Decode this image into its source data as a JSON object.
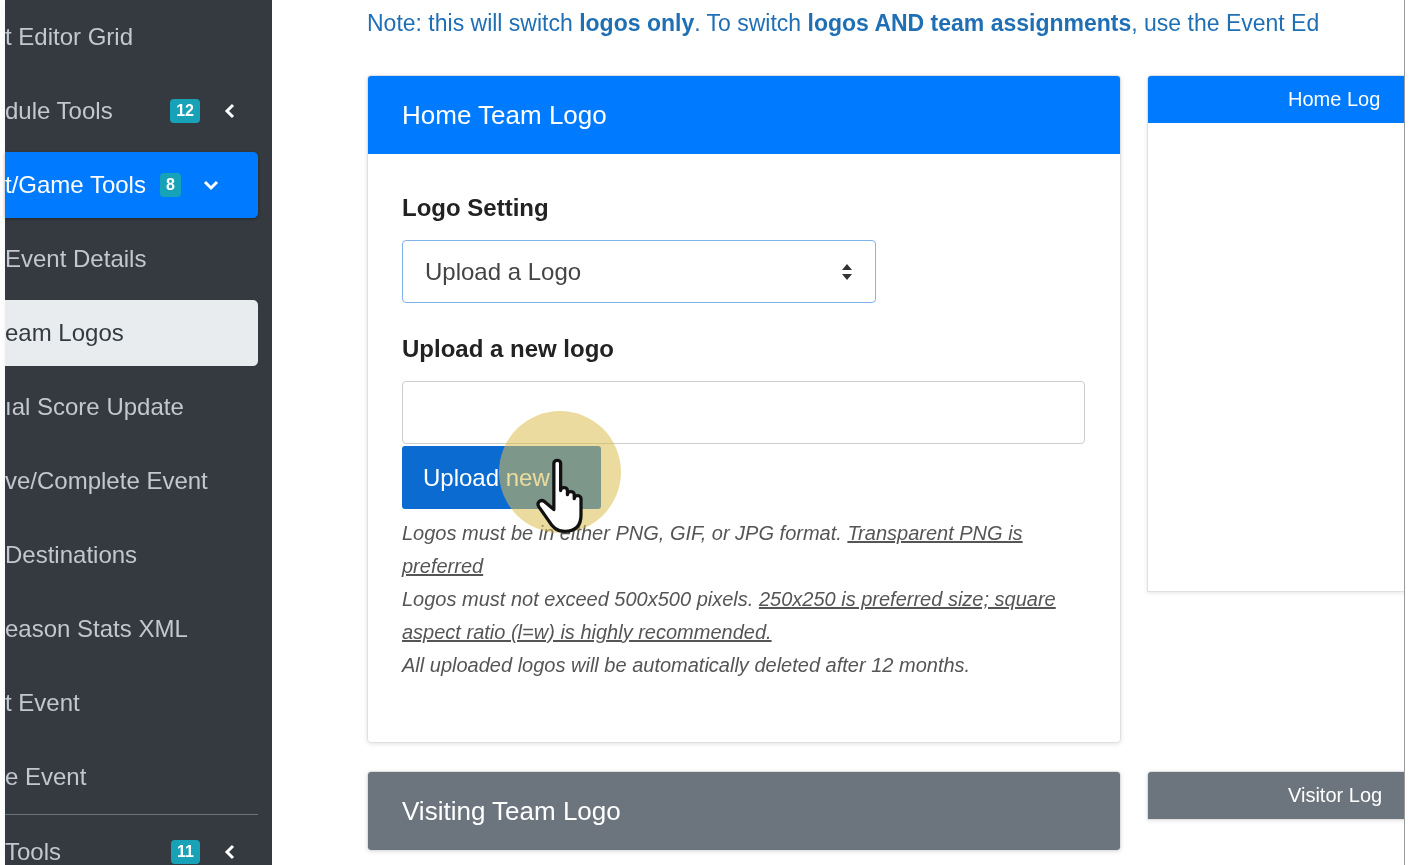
{
  "sidebar": {
    "items": [
      {
        "kind": "link",
        "label": "t Editor Grid",
        "selected": false
      },
      {
        "kind": "group",
        "label": "dule Tools",
        "badge": "12",
        "expanded": false,
        "selected": false
      },
      {
        "kind": "group",
        "label": "t/Game Tools",
        "badge": "8",
        "expanded": true,
        "selected": true,
        "children": [
          {
            "label": "Event Details",
            "selected": false
          },
          {
            "label": "eam Logos",
            "selected": true
          },
          {
            "label": "ıal Score Update",
            "selected": false
          },
          {
            "label": "ve/Complete Event",
            "selected": false
          },
          {
            "label": "Destinations",
            "selected": false
          },
          {
            "label": "eason Stats XML",
            "selected": false
          },
          {
            "label": "t Event",
            "selected": false
          },
          {
            "label": "e Event",
            "selected": false
          }
        ]
      },
      {
        "kind": "group",
        "label": "Tools",
        "badge": "11",
        "expanded": false,
        "selected": false
      }
    ]
  },
  "note": "Note: this will switch **logos only**. To switch **logos AND team assignments**, use the Event Ed",
  "home_card": {
    "title": "Home Team Logo",
    "setting_label": "Logo Setting",
    "setting_value": "Upload a Logo",
    "upload_label": "Upload a new logo",
    "upload_button": "Upload new",
    "help": [
      {
        "text": "Logos must be in either PNG, GIF, or JPG format.",
        "underlined": "Transparent PNG is preferred"
      },
      {
        "text": "Logos must not exceed 500x500 pixels.",
        "underlined": "250x250 is preferred size; square aspect ratio (l=w) is highly recommended."
      },
      {
        "text": "All uploaded logos will be automatically deleted after 12 months."
      }
    ]
  },
  "home_preview": {
    "title": "Home Log"
  },
  "visiting_card": {
    "title": "Visiting Team Logo"
  },
  "visitor_preview": {
    "title": "Visitor Log"
  },
  "cursor_highlight": true
}
